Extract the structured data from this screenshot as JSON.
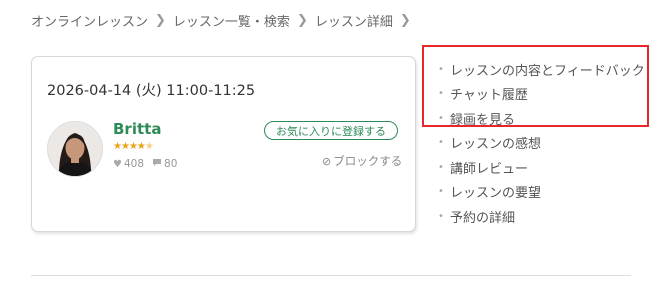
{
  "breadcrumb": {
    "items": [
      "オンラインレッスン",
      "レッスン一覧・検索",
      "レッスン詳細"
    ]
  },
  "lesson": {
    "datetime": "2026-04-14 (火) 11:00-11:25"
  },
  "teacher": {
    "name": "Britta",
    "rating": 4.5,
    "likes": "408",
    "comments": "80",
    "favorite_label": "お気に入りに登録する",
    "block_label": "ブロックする"
  },
  "menu": {
    "items": [
      "レッスンの内容とフィードバック",
      "チャット履歴",
      "録画を見る",
      "レッスンの感想",
      "講師レビュー",
      "レッスンの要望",
      "予約の詳細"
    ]
  },
  "colors": {
    "accent_green": "#2e8b57",
    "star_gold": "#e8a317",
    "highlight_red": "#e8262b"
  }
}
